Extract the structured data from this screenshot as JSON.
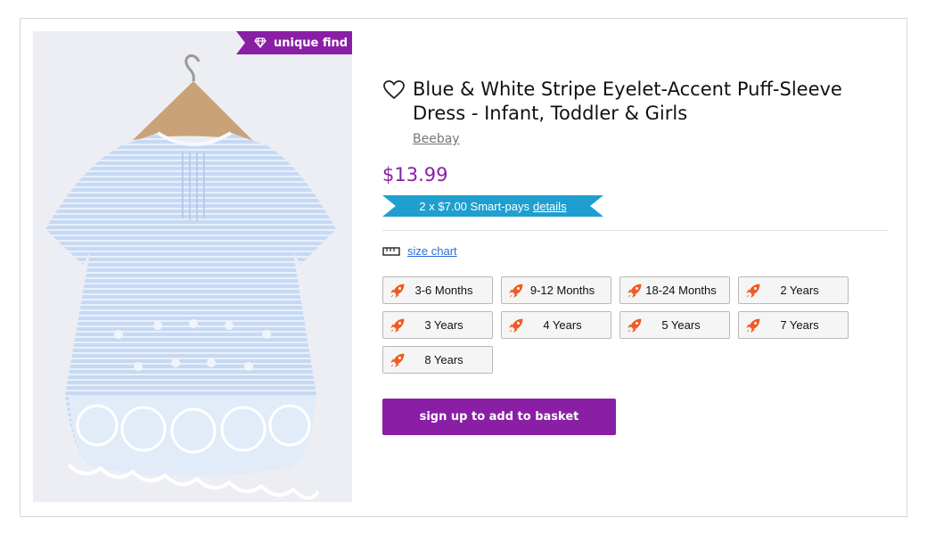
{
  "product": {
    "badge": "unique find",
    "title": "Blue & White Stripe Eyelet-Accent Puff-Sleeve Dress - Infant, Toddler & Girls",
    "brand": "Beebay",
    "price": "$13.99",
    "smartpay_text": "2 x $7.00 Smart-pays",
    "smartpay_link": "details"
  },
  "size_chart_label": "size chart",
  "sizes": [
    "3-6 Months",
    "9-12 Months",
    "18-24 Months",
    "2 Years",
    "3 Years",
    "4 Years",
    "5 Years",
    "7 Years",
    "8 Years"
  ],
  "cta_label": "sign up to add to basket",
  "colors": {
    "accent": "#8a1fa6",
    "smartpay": "#1f9fcf",
    "link": "#2a6fdb",
    "rocket": "#f15a24"
  },
  "icons": {
    "wishlist": "heart-outline-icon",
    "badge": "diamond-icon",
    "size_chart": "ruler-icon",
    "size_option": "rocket-icon"
  }
}
